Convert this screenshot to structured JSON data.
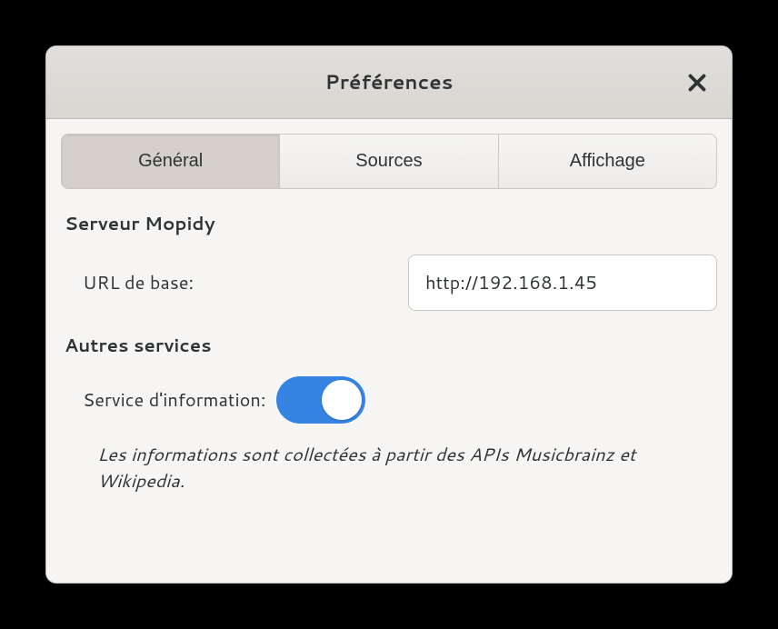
{
  "dialog": {
    "title": "Préférences"
  },
  "tabs": {
    "general": "Général",
    "sources": "Sources",
    "display": "Affichage"
  },
  "sections": {
    "mopidy": {
      "title": "Serveur Mopidy",
      "url_label": "URL de base:",
      "url_value": "http://192.168.1.45"
    },
    "services": {
      "title": "Autres services",
      "info_label": "Service d'information:",
      "description": "Les informations sont collectées à partir des APIs Musicbrainz et Wikipedia."
    }
  }
}
